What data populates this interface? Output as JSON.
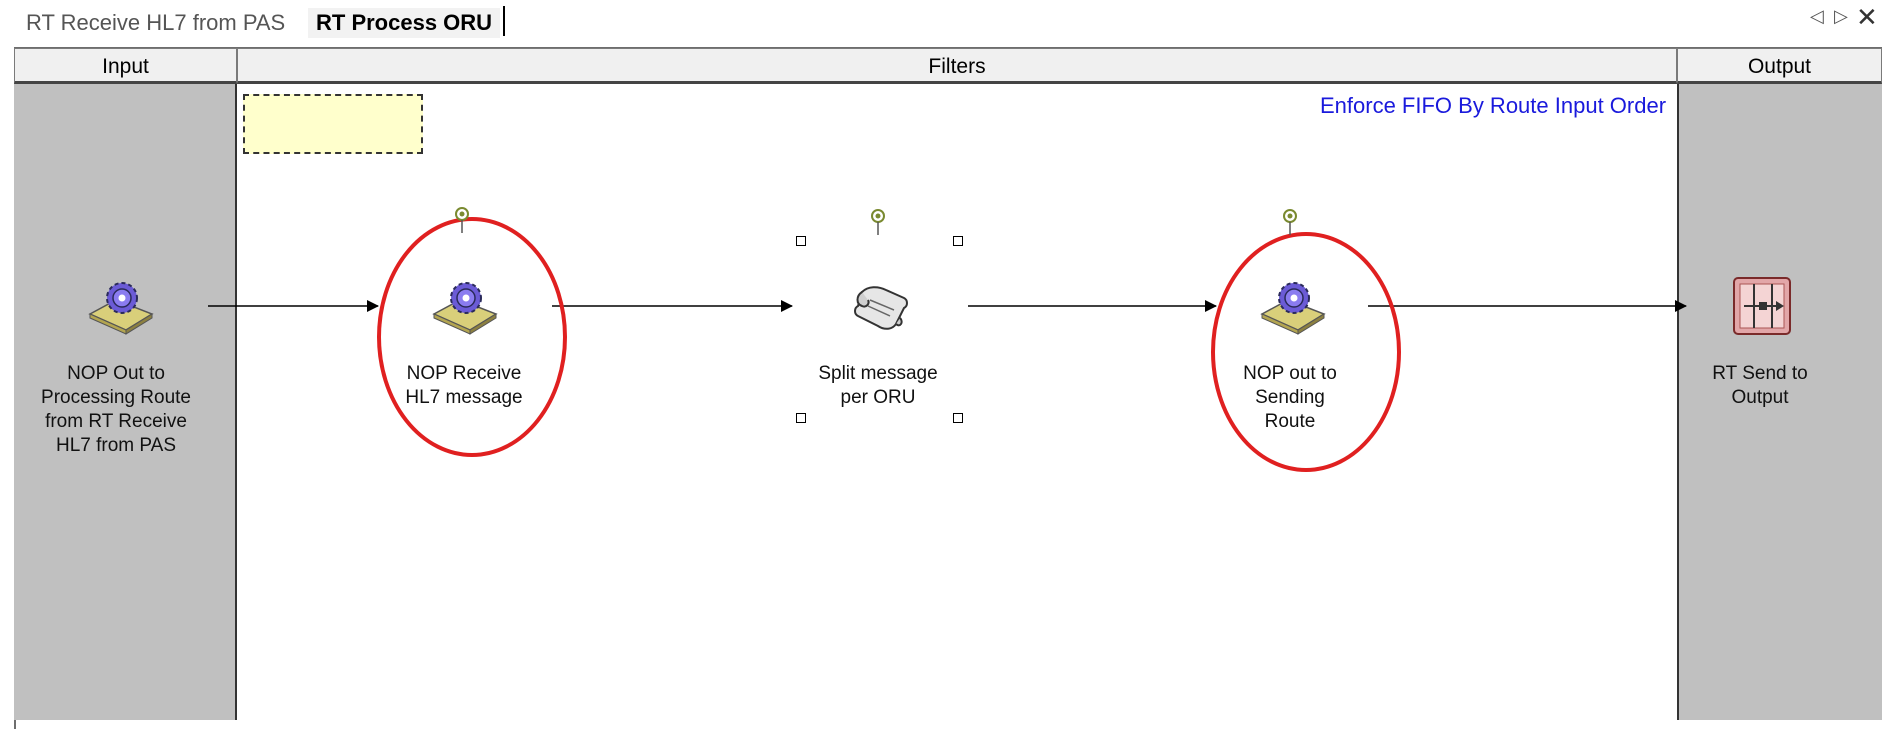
{
  "tabs": [
    {
      "label": "RT Receive HL7 from PAS",
      "active": false
    },
    {
      "label": "RT Process ORU",
      "active": true
    }
  ],
  "window_controls": {
    "prev": "◁",
    "next": "▷",
    "close": "✕"
  },
  "columns": {
    "input": "Input",
    "filters": "Filters",
    "output": "Output"
  },
  "fifo_link": "Enforce FIFO By Route Input Order",
  "nodes": {
    "input": {
      "label": "NOP Out to Processing Route from RT Receive HL7 from PAS",
      "icon": "gear-package-icon"
    },
    "filter1": {
      "label": "NOP Receive HL7 message",
      "icon": "gear-package-icon",
      "highlighted": true
    },
    "filter2": {
      "label": "Split message per ORU",
      "icon": "scroll-icon",
      "selected": true
    },
    "filter3": {
      "label": "NOP out to Sending Route",
      "icon": "gear-package-icon",
      "highlighted": true
    },
    "output": {
      "label": "RT Send to Output",
      "icon": "send-output-icon"
    }
  },
  "colors": {
    "highlight": "#e02020",
    "link": "#1a1adc",
    "pane": "#c0c0c0",
    "note": "#ffffcc",
    "gear": "#6b5bd6"
  }
}
